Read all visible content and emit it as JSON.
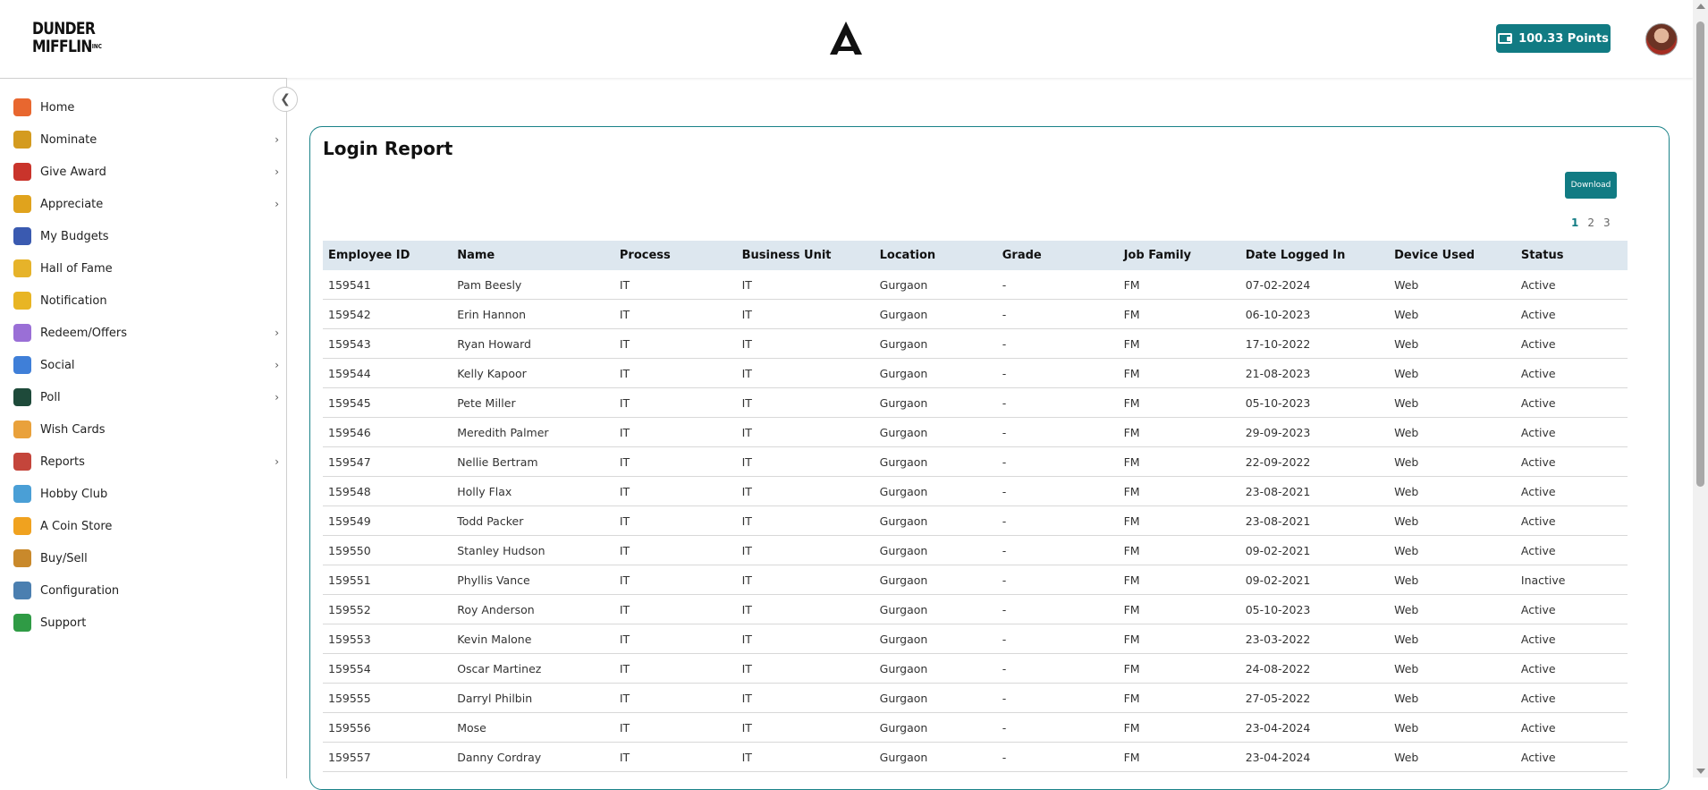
{
  "header": {
    "logo_line1": "DUNDER",
    "logo_line2": "MIFFLIN",
    "logo_suffix": "INC",
    "points_label": "100.33  Points",
    "accent": "#117b83"
  },
  "sidebar": {
    "items": [
      {
        "label": "Home",
        "icon": "home-icon",
        "color": "#e8672f",
        "has_sub": false
      },
      {
        "label": "Nominate",
        "icon": "trophy-icon",
        "color": "#d49b1f",
        "has_sub": true
      },
      {
        "label": "Give Award",
        "icon": "gift-icon",
        "color": "#c9342b",
        "has_sub": true
      },
      {
        "label": "Appreciate",
        "icon": "medal-icon",
        "color": "#e0a31d",
        "has_sub": true
      },
      {
        "label": "My Budgets",
        "icon": "wallet-icon",
        "color": "#3a5ab0",
        "has_sub": false
      },
      {
        "label": "Hall of Fame",
        "icon": "crown-icon",
        "color": "#e6b32a",
        "has_sub": false
      },
      {
        "label": "Notification",
        "icon": "bell-icon",
        "color": "#e8b524",
        "has_sub": false
      },
      {
        "label": "Redeem/Offers",
        "icon": "voucher-icon",
        "color": "#9a6fd6",
        "has_sub": true
      },
      {
        "label": "Social",
        "icon": "chat-icon",
        "color": "#3f7fd8",
        "has_sub": true
      },
      {
        "label": "Poll",
        "icon": "poll-icon",
        "color": "#1e4a3a",
        "has_sub": true
      },
      {
        "label": "Wish Cards",
        "icon": "party-icon",
        "color": "#e9a13b",
        "has_sub": false
      },
      {
        "label": "Reports",
        "icon": "clipboard-icon",
        "color": "#c4453b",
        "has_sub": true
      },
      {
        "label": "Hobby Club",
        "icon": "hobby-icon",
        "color": "#4a9fd6",
        "has_sub": false
      },
      {
        "label": "A Coin Store",
        "icon": "coin-icon",
        "color": "#f0a21f",
        "has_sub": false
      },
      {
        "label": "Buy/Sell",
        "icon": "shopping-bag-icon",
        "color": "#c9892b",
        "has_sub": false
      },
      {
        "label": "Configuration",
        "icon": "monitor-icon",
        "color": "#4b7fb0",
        "has_sub": false
      },
      {
        "label": "Support",
        "icon": "phone-icon",
        "color": "#2f9b45",
        "has_sub": false
      }
    ]
  },
  "main": {
    "title": "Login Report",
    "download_label": "Download",
    "pages": [
      "1",
      "2",
      "3"
    ],
    "active_page": "1",
    "columns": [
      "Employee ID",
      "Name",
      "Process",
      "Business Unit",
      "Location",
      "Grade",
      "Job Family",
      "Date Logged In",
      "Device Used",
      "Status"
    ],
    "rows": [
      [
        "159541",
        "Pam Beesly",
        "IT",
        "IT",
        "Gurgaon",
        "-",
        "FM",
        "07-02-2024",
        "Web",
        "Active"
      ],
      [
        "159542",
        "Erin Hannon",
        "IT",
        "IT",
        "Gurgaon",
        "-",
        "FM",
        "06-10-2023",
        "Web",
        "Active"
      ],
      [
        "159543",
        "Ryan Howard",
        "IT",
        "IT",
        "Gurgaon",
        "-",
        "FM",
        "17-10-2022",
        "Web",
        "Active"
      ],
      [
        "159544",
        "Kelly Kapoor",
        "IT",
        "IT",
        "Gurgaon",
        "-",
        "FM",
        "21-08-2023",
        "Web",
        "Active"
      ],
      [
        "159545",
        "Pete Miller",
        "IT",
        "IT",
        "Gurgaon",
        "-",
        "FM",
        "05-10-2023",
        "Web",
        "Active"
      ],
      [
        "159546",
        "Meredith Palmer",
        "IT",
        "IT",
        "Gurgaon",
        "-",
        "FM",
        "29-09-2023",
        "Web",
        "Active"
      ],
      [
        "159547",
        "Nellie Bertram",
        "IT",
        "IT",
        "Gurgaon",
        "-",
        "FM",
        "22-09-2022",
        "Web",
        "Active"
      ],
      [
        "159548",
        "Holly Flax",
        "IT",
        "IT",
        "Gurgaon",
        "-",
        "FM",
        "23-08-2021",
        "Web",
        "Active"
      ],
      [
        "159549",
        "Todd Packer",
        "IT",
        "IT",
        "Gurgaon",
        "-",
        "FM",
        "23-08-2021",
        "Web",
        "Active"
      ],
      [
        "159550",
        "Stanley Hudson",
        "IT",
        "IT",
        "Gurgaon",
        "-",
        "FM",
        "09-02-2021",
        "Web",
        "Active"
      ],
      [
        "159551",
        "Phyllis Vance",
        "IT",
        "IT",
        "Gurgaon",
        "-",
        "FM",
        "09-02-2021",
        "Web",
        "Inactive"
      ],
      [
        "159552",
        "Roy Anderson",
        "IT",
        "IT",
        "Gurgaon",
        "-",
        "FM",
        "05-10-2023",
        "Web",
        "Active"
      ],
      [
        "159553",
        "Kevin Malone",
        "IT",
        "IT",
        "Gurgaon",
        "-",
        "FM",
        "23-03-2022",
        "Web",
        "Active"
      ],
      [
        "159554",
        "Oscar Martinez",
        "IT",
        "IT",
        "Gurgaon",
        "-",
        "FM",
        "24-08-2022",
        "Web",
        "Active"
      ],
      [
        "159555",
        "Darryl Philbin",
        "IT",
        "IT",
        "Gurgaon",
        "-",
        "FM",
        "27-05-2022",
        "Web",
        "Active"
      ],
      [
        "159556",
        "Mose",
        "IT",
        "IT",
        "Gurgaon",
        "-",
        "FM",
        "23-04-2024",
        "Web",
        "Active"
      ],
      [
        "159557",
        "Danny Cordray",
        "IT",
        "IT",
        "Gurgaon",
        "-",
        "FM",
        "23-04-2024",
        "Web",
        "Active"
      ]
    ]
  }
}
